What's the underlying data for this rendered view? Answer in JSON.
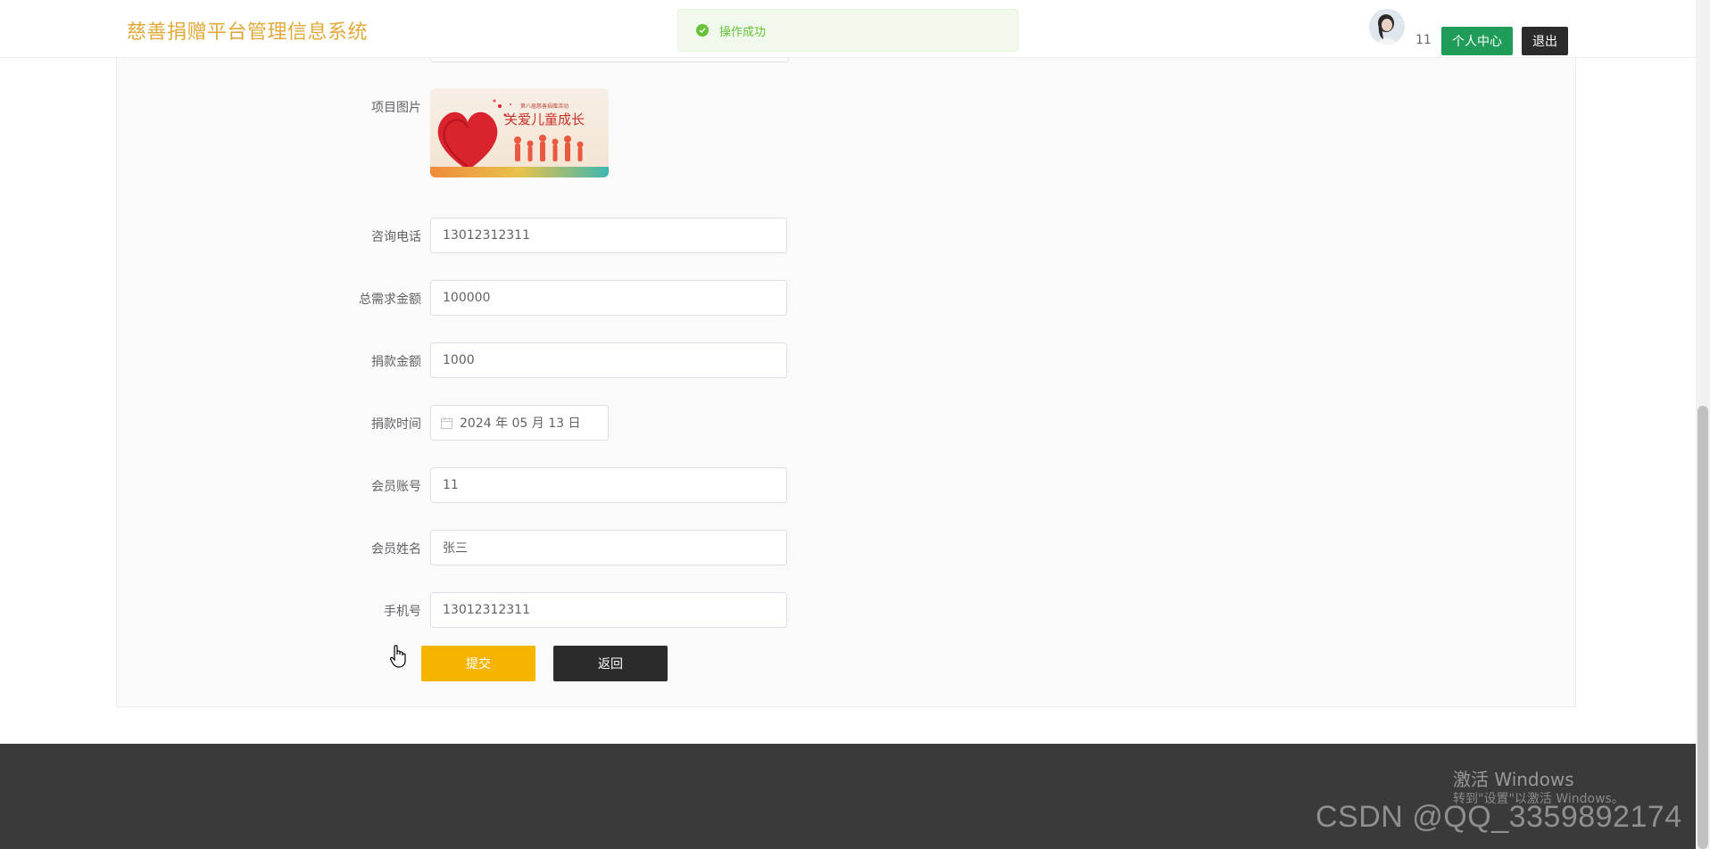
{
  "header": {
    "brand": "慈善捐赠平台管理信息系统",
    "username": "11",
    "profile_button": "个人中心",
    "logout_button": "退出"
  },
  "toast": {
    "message": "操作成功"
  },
  "form": {
    "image_label": "项目图片",
    "image_caption": "关爱儿童成长",
    "image_small_text": "第八届慈善捐赠活动",
    "phone_label": "咨询电话",
    "phone_value": "13012312311",
    "total_label": "总需求金额",
    "total_value": "100000",
    "donation_label": "捐款金额",
    "donation_value": "1000",
    "date_label": "捐款时间",
    "date_value": "2024 年 05 月 13 日",
    "account_label": "会员账号",
    "account_value": "11",
    "name_label": "会员姓名",
    "name_value": "张三",
    "mobile_label": "手机号",
    "mobile_value": "13012312311",
    "submit_button": "提交",
    "back_button": "返回"
  },
  "footer": {
    "activate_title": "激活 Windows",
    "activate_sub": "转到\"设置\"以激活 Windows。",
    "watermark": "CSDN @QQ_3359892174"
  },
  "colors": {
    "brand": "#e2a93a",
    "profile_button": "#1f9c57",
    "submit_button": "#f4b400",
    "dark_button": "#2b2b2b",
    "success": "#67c23a",
    "footer": "#3a3a3a"
  }
}
